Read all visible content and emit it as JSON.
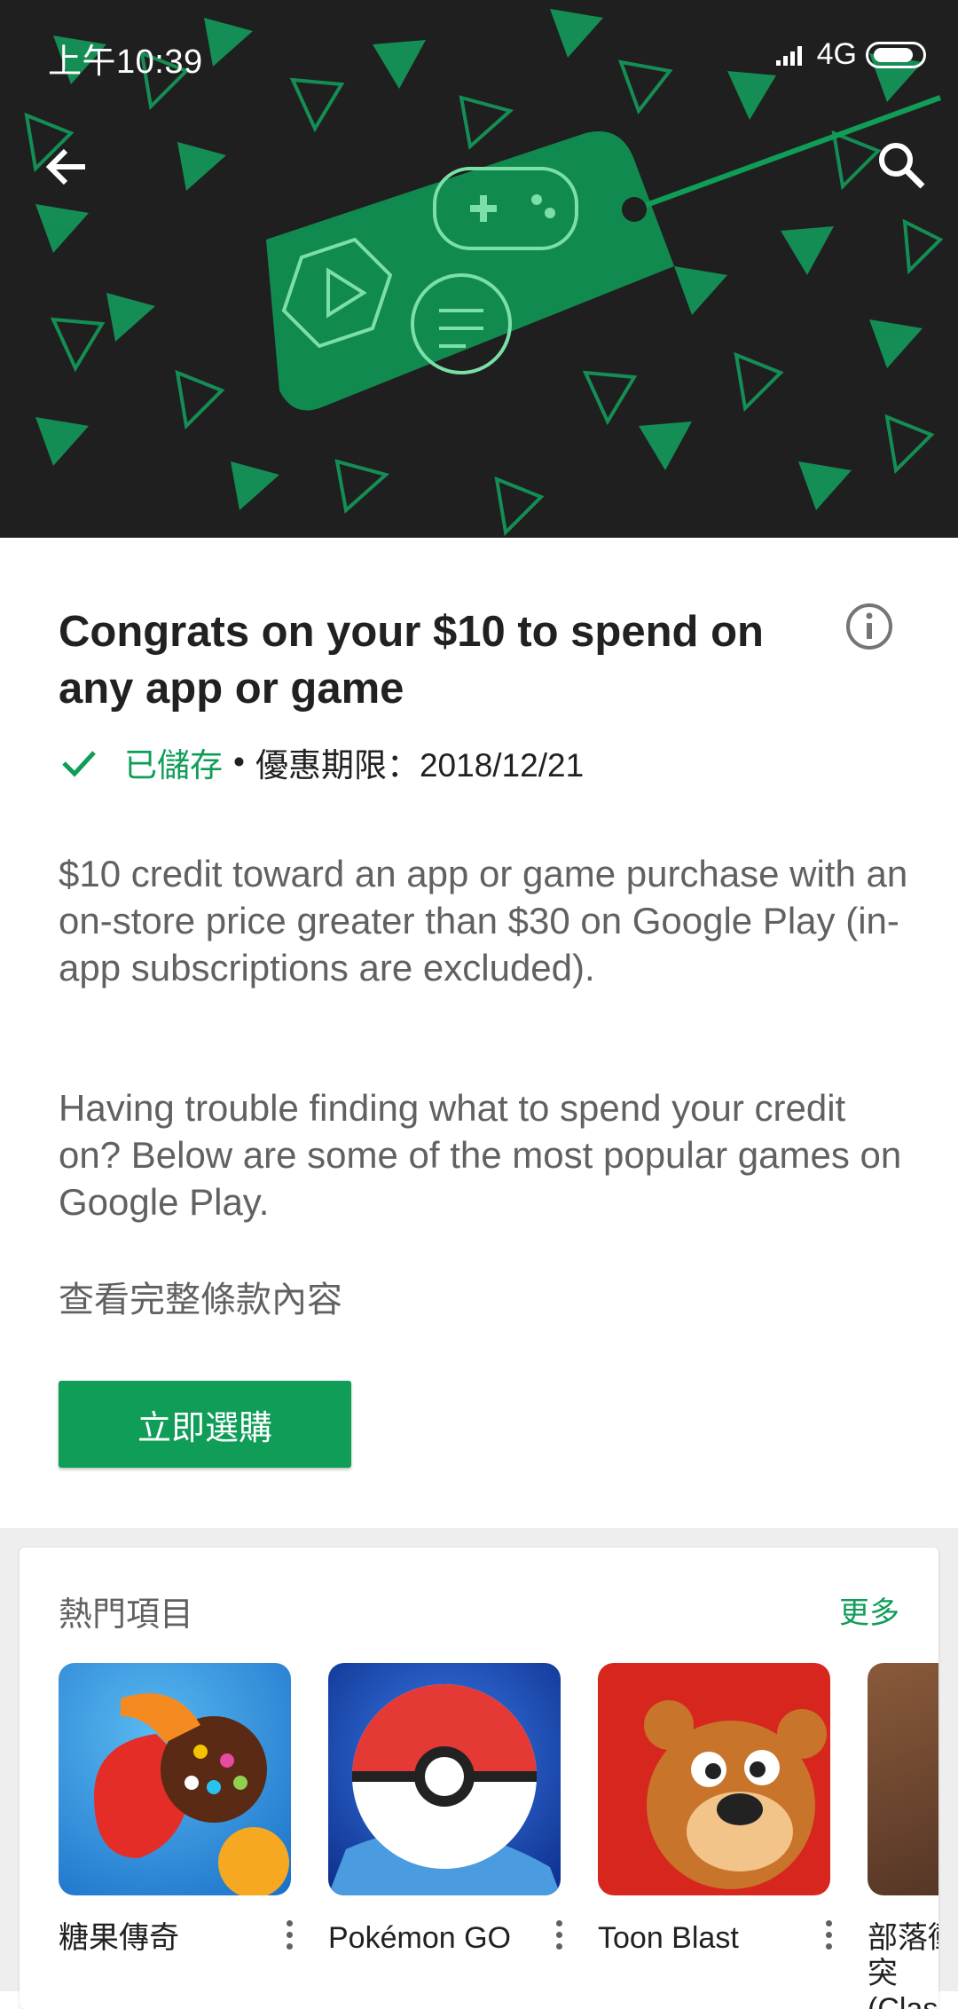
{
  "status_bar": {
    "time": "上午10:39",
    "network": "4G"
  },
  "header": {
    "back_icon": "arrow-back-icon",
    "search_icon": "search-icon"
  },
  "offer": {
    "title": "Congrats on your $10 to spend on any app or game",
    "saved_label": "已儲存",
    "separator": "•",
    "expiry_label": "優惠期限：2018/12/21",
    "description_1": "$10 credit toward an app or game purchase with an on-store price greater than $30 on Google Play (in-app subscriptions are excluded).",
    "description_2": "Having trouble finding what to spend your credit on? Below are some of the most popular games on Google Play.",
    "terms_link": "查看完整條款內容",
    "buy_button": "立即選購"
  },
  "popular": {
    "title": "熱門項目",
    "more_label": "更多",
    "apps": [
      {
        "name": "糖果傳奇"
      },
      {
        "name": "Pokémon GO"
      },
      {
        "name": "Toon Blast"
      },
      {
        "name": "部落衝突 (Clas"
      }
    ]
  },
  "colors": {
    "accent": "#0f9d58",
    "hero_bg": "#1f1f1f",
    "hero_green": "#0f9d58"
  }
}
